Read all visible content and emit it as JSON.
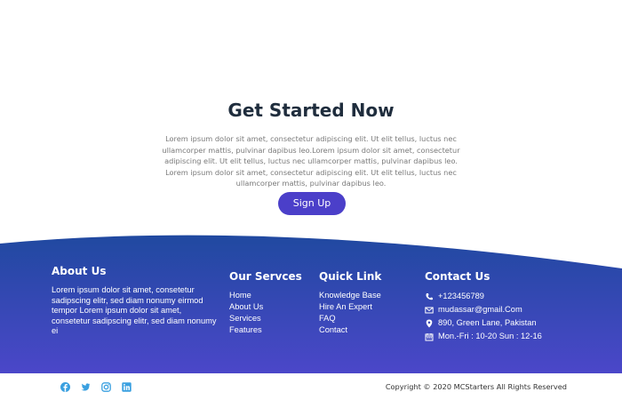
{
  "cta": {
    "title": "Get Started Now",
    "body": "Lorem ipsum dolor sit amet, consectetur adipiscing elit. Ut elit tellus, luctus nec ullamcorper mattis, pulvinar dapibus leo.Lorem ipsum dolor sit amet, consectetur adipiscing elit. Ut elit tellus, luctus nec ullamcorper mattis, pulvinar dapibus leo. Lorem ipsum dolor sit amet, consectetur adipiscing elit. Ut elit tellus, luctus nec ullamcorper mattis, pulvinar dapibus leo.",
    "button_label": "Sign Up"
  },
  "footer": {
    "about": {
      "title": "About Us",
      "text": "Lorem ipsum dolor sit amet, consetetur sadipscing elitr, sed diam nonumy eirmod tempor Lorem ipsum dolor sit amet, consetetur sadipscing elitr, sed diam nonumy ei"
    },
    "services": {
      "title": "Our Servces",
      "items": [
        "Home",
        "About Us",
        "Services",
        "Features"
      ]
    },
    "quick_links": {
      "title": "Quick Link",
      "items": [
        "Knowledge Base",
        "Hire An Expert",
        "FAQ",
        "Contact"
      ]
    },
    "contact": {
      "title": "Contact Us",
      "phone": "+123456789",
      "email": "mudassar@gmail.Com",
      "address": "890, Green Lane, Pakistan",
      "hours": "Mon.-Fri : 10-20 Sun : 12-16"
    },
    "colors": {
      "gradient_top": "#2049a0",
      "gradient_bottom": "#4b47c9",
      "button": "#4b3fc9",
      "social": "#3aa0e0"
    }
  },
  "bottom": {
    "social_icons": [
      "facebook-icon",
      "twitter-icon",
      "instagram-icon",
      "linkedin-icon"
    ],
    "copyright": "Copyright © 2020 MCStarters All Rights Reserved"
  }
}
